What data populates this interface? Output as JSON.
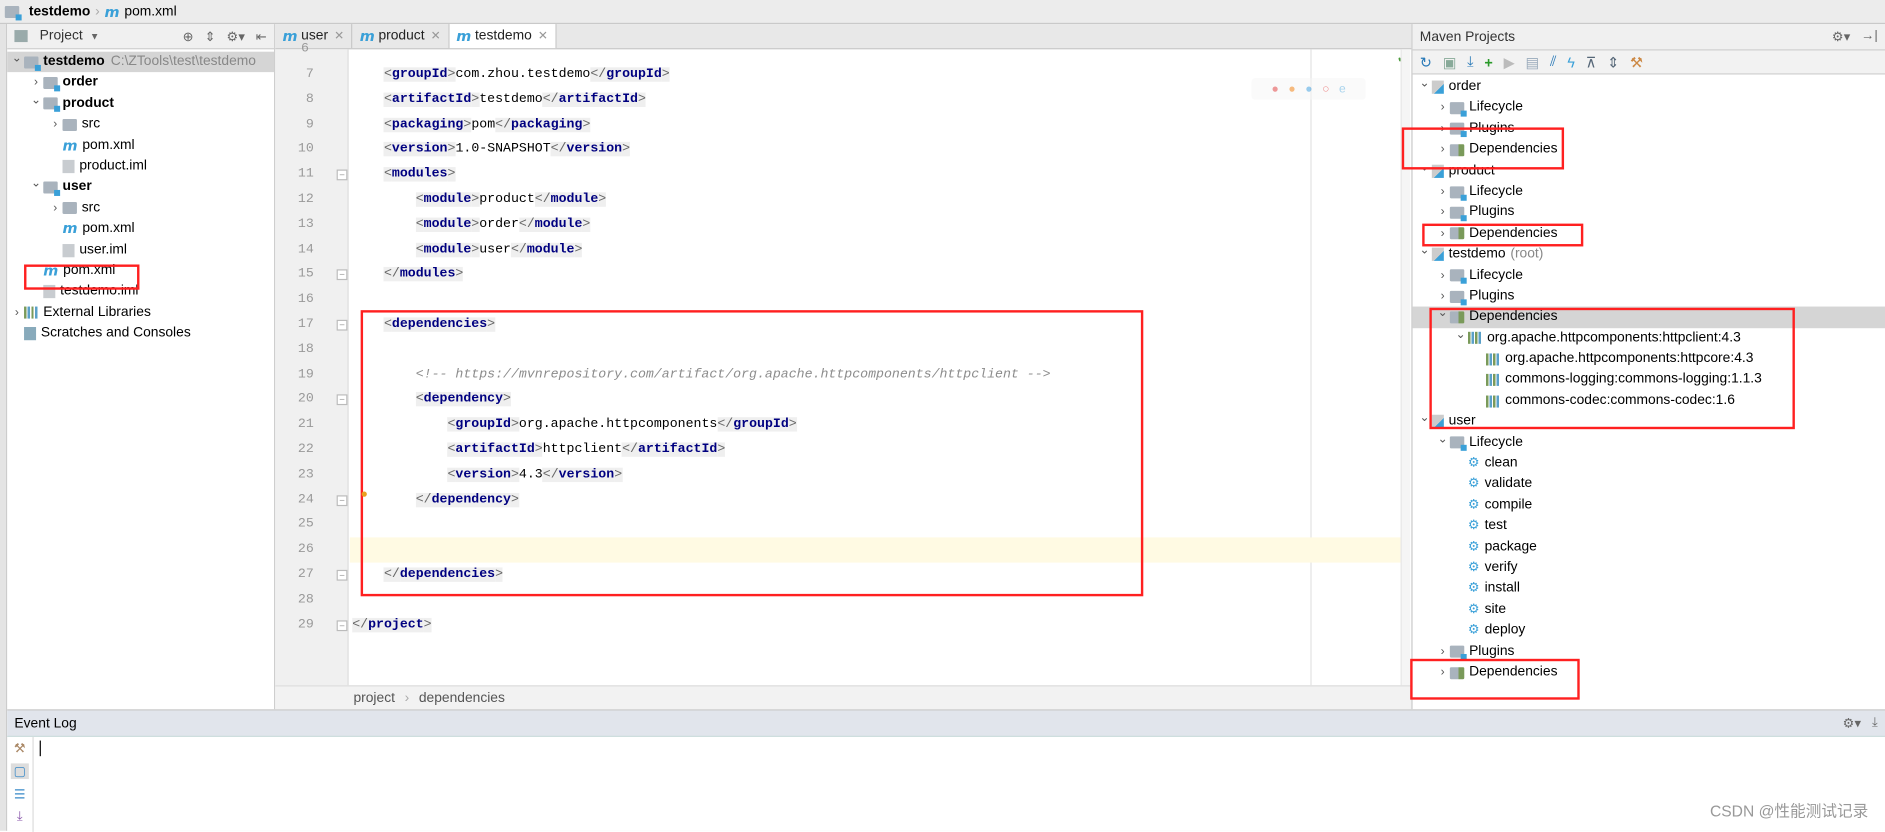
{
  "navbar": {
    "project": "testdemo",
    "file": "pom.xml"
  },
  "project_panel": {
    "title": "Project",
    "tree": [
      {
        "label": "testdemo",
        "path": "C:\\ZTools\\test\\testdemo",
        "level": 0,
        "arrow": "down",
        "icon": "module-folder",
        "bold": true,
        "selected": true
      },
      {
        "label": "order",
        "level": 1,
        "arrow": "right",
        "icon": "module-folder",
        "bold": true
      },
      {
        "label": "product",
        "level": 1,
        "arrow": "down",
        "icon": "module-folder",
        "bold": true
      },
      {
        "label": "src",
        "level": 2,
        "arrow": "right",
        "icon": "folder"
      },
      {
        "label": "pom.xml",
        "level": 2,
        "icon": "maven-file"
      },
      {
        "label": "product.iml",
        "level": 2,
        "icon": "iml-file"
      },
      {
        "label": "user",
        "level": 1,
        "arrow": "down",
        "icon": "module-folder",
        "bold": true
      },
      {
        "label": "src",
        "level": 2,
        "arrow": "right",
        "icon": "folder"
      },
      {
        "label": "pom.xml",
        "level": 2,
        "icon": "maven-file"
      },
      {
        "label": "user.iml",
        "level": 2,
        "icon": "iml-file"
      },
      {
        "label": "pom.xml",
        "level": 1,
        "icon": "maven-file"
      },
      {
        "label": "testdemo.iml",
        "level": 1,
        "icon": "iml-file"
      },
      {
        "label": "External Libraries",
        "level": 0,
        "arrow": "right",
        "icon": "library"
      },
      {
        "label": "Scratches and Consoles",
        "level": 0,
        "icon": "scratches"
      }
    ]
  },
  "editor": {
    "tabs": [
      {
        "label": "user",
        "active": false
      },
      {
        "label": "product",
        "active": false
      },
      {
        "label": "testdemo",
        "active": true
      }
    ],
    "first_line": 7,
    "current_line": 26,
    "lines": [
      "    <groupId>com.zhou.testdemo</groupId>",
      "    <artifactId>testdemo</artifactId>",
      "    <packaging>pom</packaging>",
      "    <version>1.0-SNAPSHOT</version>",
      "    <modules>",
      "        <module>product</module>",
      "        <module>order</module>",
      "        <module>user</module>",
      "    </modules>",
      "",
      "    <dependencies>",
      "",
      "        <!-- https://mvnrepository.com/artifact/org.apache.httpcomponents/httpclient -->",
      "        <dependency>",
      "            <groupId>org.apache.httpcomponents</groupId>",
      "            <artifactId>httpclient</artifactId>",
      "            <version>4.3</version>",
      "        </dependency>",
      "",
      "",
      "    </dependencies>",
      "",
      "</project>"
    ],
    "breadcrumb": [
      "project",
      "dependencies"
    ]
  },
  "maven": {
    "title": "Maven Projects",
    "tree": [
      {
        "label": "order",
        "level": 0,
        "arrow": "down",
        "icon": "maven-module"
      },
      {
        "label": "Lifecycle",
        "level": 1,
        "arrow": "right",
        "icon": "folder-gear"
      },
      {
        "label": "Plugins",
        "level": 1,
        "arrow": "right",
        "icon": "folder-gear"
      },
      {
        "label": "Dependencies",
        "level": 1,
        "arrow": "right",
        "icon": "folder-lib"
      },
      {
        "label": "product",
        "level": 0,
        "arrow": "down",
        "icon": "maven-module"
      },
      {
        "label": "Lifecycle",
        "level": 1,
        "arrow": "right",
        "icon": "folder-gear"
      },
      {
        "label": "Plugins",
        "level": 1,
        "arrow": "right",
        "icon": "folder-gear"
      },
      {
        "label": "Dependencies",
        "level": 1,
        "arrow": "right",
        "icon": "folder-lib"
      },
      {
        "label": "testdemo",
        "suffix": "(root)",
        "level": 0,
        "arrow": "down",
        "icon": "maven-module"
      },
      {
        "label": "Lifecycle",
        "level": 1,
        "arrow": "right",
        "icon": "folder-gear"
      },
      {
        "label": "Plugins",
        "level": 1,
        "arrow": "right",
        "icon": "folder-gear"
      },
      {
        "label": "Dependencies",
        "level": 1,
        "arrow": "down",
        "icon": "folder-lib",
        "selected": true
      },
      {
        "label": "org.apache.httpcomponents:httpclient:4.3",
        "level": 2,
        "arrow": "down",
        "icon": "library"
      },
      {
        "label": "org.apache.httpcomponents:httpcore:4.3",
        "level": 3,
        "icon": "library"
      },
      {
        "label": "commons-logging:commons-logging:1.1.3",
        "level": 3,
        "icon": "library"
      },
      {
        "label": "commons-codec:commons-codec:1.6",
        "level": 3,
        "icon": "library"
      },
      {
        "label": "user",
        "level": 0,
        "arrow": "down",
        "icon": "maven-module"
      },
      {
        "label": "Lifecycle",
        "level": 1,
        "arrow": "down",
        "icon": "folder-gear"
      },
      {
        "label": "clean",
        "level": 2,
        "icon": "gear"
      },
      {
        "label": "validate",
        "level": 2,
        "icon": "gear"
      },
      {
        "label": "compile",
        "level": 2,
        "icon": "gear"
      },
      {
        "label": "test",
        "level": 2,
        "icon": "gear"
      },
      {
        "label": "package",
        "level": 2,
        "icon": "gear"
      },
      {
        "label": "verify",
        "level": 2,
        "icon": "gear"
      },
      {
        "label": "install",
        "level": 2,
        "icon": "gear"
      },
      {
        "label": "site",
        "level": 2,
        "icon": "gear"
      },
      {
        "label": "deploy",
        "level": 2,
        "icon": "gear"
      },
      {
        "label": "Plugins",
        "level": 1,
        "arrow": "right",
        "icon": "folder-gear"
      },
      {
        "label": "Dependencies",
        "level": 1,
        "arrow": "right",
        "icon": "folder-lib"
      }
    ]
  },
  "event_log": {
    "title": "Event Log"
  },
  "watermark": "CSDN @性能测试记录",
  "colors": {
    "highlight_box": "#ff2020",
    "tag": "#000080",
    "current_line": "#fffae3",
    "maven_icon": "#3aa0d8"
  }
}
